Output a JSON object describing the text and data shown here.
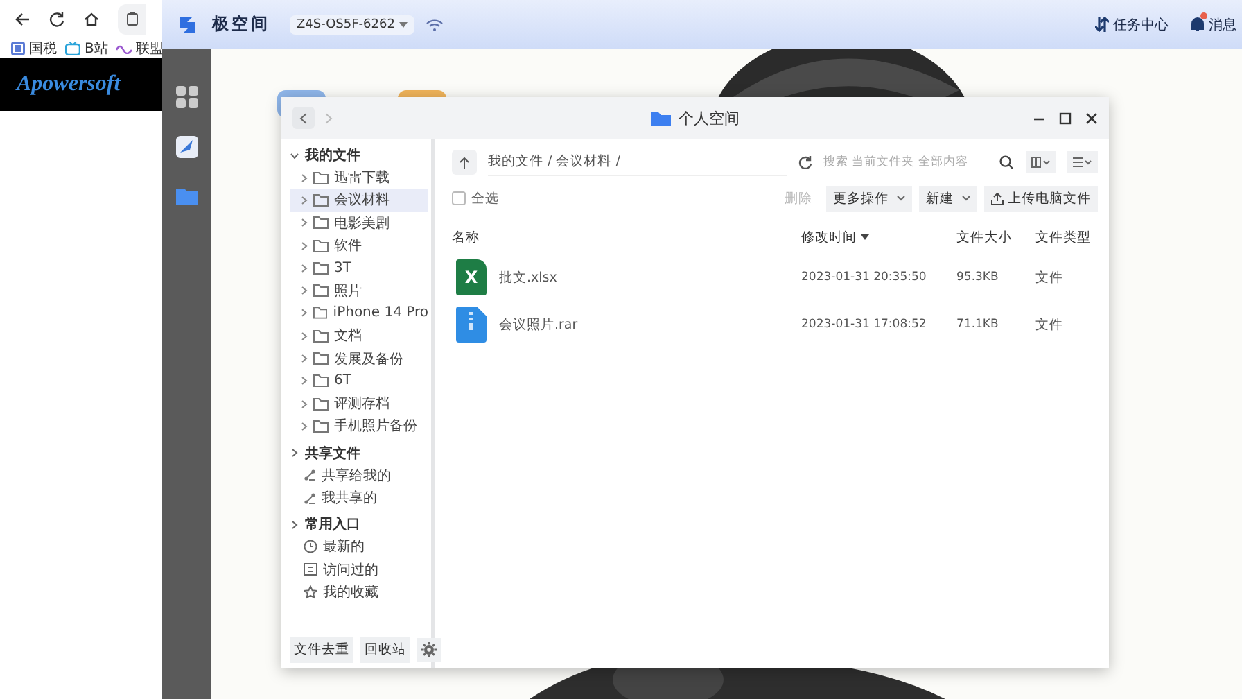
{
  "browser": {
    "bookmarks": [
      {
        "label": "国税"
      },
      {
        "label": "B站"
      },
      {
        "label": "联盟"
      }
    ],
    "banner": {
      "logo": "Apowersoft"
    }
  },
  "app": {
    "title": "极空间",
    "device": "Z4S-OS5F-6262",
    "actions": [
      {
        "kind": "tasks",
        "label": "任务中心",
        "badge": false
      },
      {
        "kind": "messages",
        "label": "消息",
        "badge": true
      }
    ]
  },
  "window": {
    "title": "个人空间"
  },
  "sidebar": {
    "sections": [
      {
        "label": "我的文件",
        "expanded": true,
        "items": [
          {
            "label": "迅雷下载",
            "kind": "folder",
            "selected": false
          },
          {
            "label": "会议材料",
            "kind": "folder",
            "selected": true
          },
          {
            "label": "电影美剧",
            "kind": "folder",
            "selected": false
          },
          {
            "label": "软件",
            "kind": "folder",
            "selected": false
          },
          {
            "label": "3T",
            "kind": "folder",
            "selected": false
          },
          {
            "label": "照片",
            "kind": "folder",
            "selected": false
          },
          {
            "label": "iPhone 14 Pro",
            "kind": "folder",
            "selected": false
          },
          {
            "label": "文档",
            "kind": "folder",
            "selected": false
          },
          {
            "label": "发展及备份",
            "kind": "folder",
            "selected": false
          },
          {
            "label": "6T",
            "kind": "folder",
            "selected": false
          },
          {
            "label": "评测存档",
            "kind": "folder",
            "selected": false
          },
          {
            "label": "手机照片备份",
            "kind": "folder",
            "selected": false
          }
        ]
      },
      {
        "label": "共享文件",
        "expanded": false,
        "items": [
          {
            "label": "共享给我的",
            "kind": "share",
            "selected": false
          },
          {
            "label": "我共享的",
            "kind": "share",
            "selected": false
          }
        ]
      },
      {
        "label": "常用入口",
        "expanded": false,
        "items": [
          {
            "label": "最新的",
            "kind": "recent",
            "selected": false
          },
          {
            "label": "访问过的",
            "kind": "visited",
            "selected": false
          },
          {
            "label": "我的收藏",
            "kind": "favorite",
            "selected": false
          }
        ]
      }
    ],
    "footer_buttons": [
      "文件去重",
      "回收站"
    ]
  },
  "content": {
    "path": "我的文件 / 会议材料 /",
    "search": {
      "placeholder": "搜索 当前文件夹 全部内容"
    },
    "select_all": {
      "label": "全选",
      "checked": false
    },
    "actions": [
      {
        "label": "删除",
        "disabled": true,
        "dropdown": false,
        "kind": "plain"
      },
      {
        "label": "更多操作",
        "disabled": false,
        "dropdown": true,
        "kind": "plain"
      },
      {
        "label": "新建",
        "disabled": false,
        "dropdown": true,
        "kind": "plain"
      },
      {
        "label": "上传电脑文件",
        "disabled": false,
        "dropdown": false,
        "kind": "upload"
      }
    ],
    "columns": [
      {
        "label": "名称",
        "sorted": false
      },
      {
        "label": "修改时间",
        "sorted": true
      },
      {
        "label": "文件大小",
        "sorted": false
      },
      {
        "label": "文件类型",
        "sorted": false
      }
    ],
    "rows": [
      {
        "kind": "excel",
        "icon_text": "X",
        "name": "批文.xlsx",
        "modified": "2023-01-31 20:35:50",
        "size": "95.3KB",
        "type": "文件"
      },
      {
        "kind": "archive",
        "name": "会议照片.rar",
        "modified": "2023-01-31 17:08:52",
        "size": "71.1KB",
        "type": "文件"
      }
    ]
  }
}
